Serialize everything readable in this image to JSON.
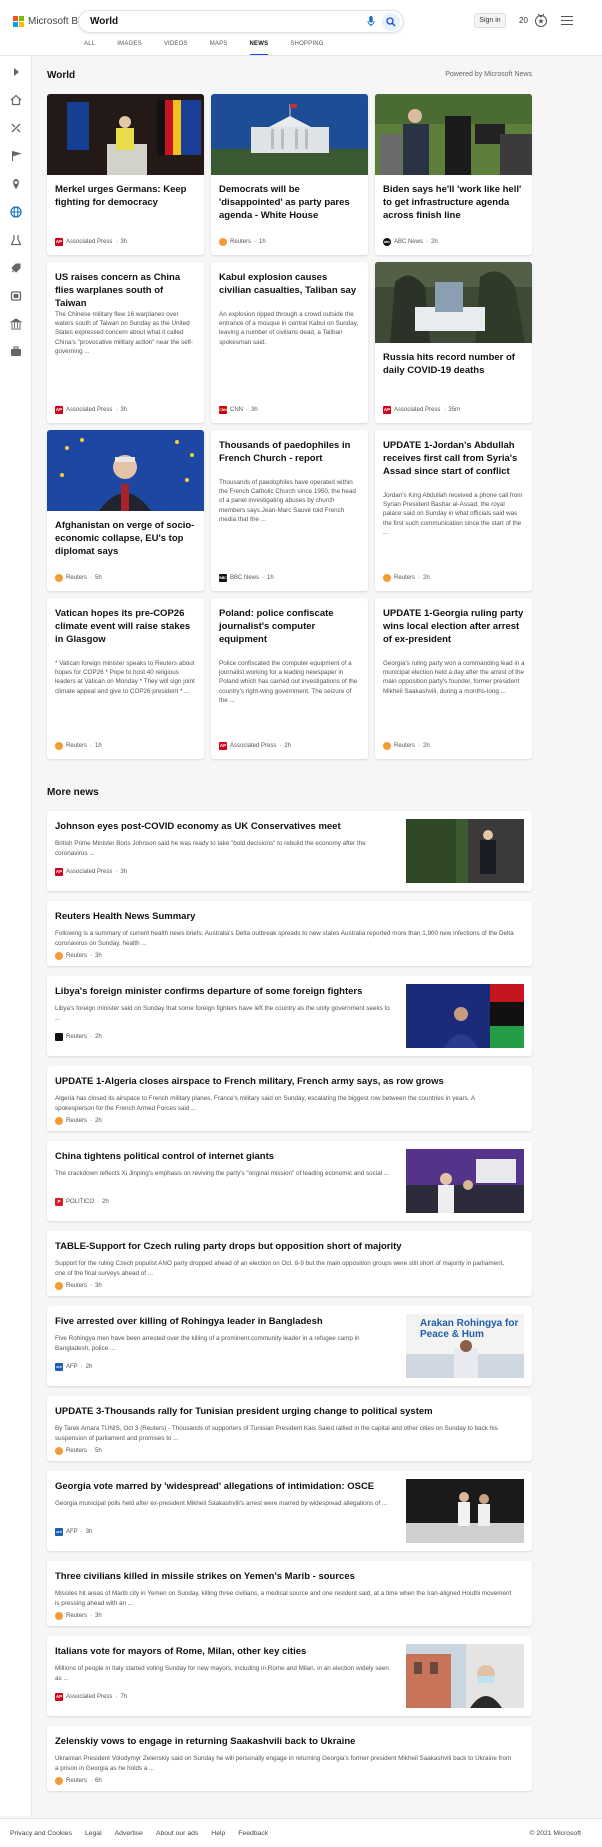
{
  "header": {
    "logo_text": "Microsoft Bing",
    "search_value": "World",
    "signin_label": "Sign in",
    "points": "20",
    "tabs": [
      "ALL",
      "IMAGES",
      "VIDEOS",
      "MAPS",
      "NEWS",
      "SHOPPING"
    ],
    "active_tab": "NEWS"
  },
  "rail_icons": [
    "expand-icon",
    "home-icon",
    "sports-icon",
    "flag-icon",
    "location-icon",
    "globe-icon",
    "science-icon",
    "tech-icon",
    "entertainment-icon",
    "politics-icon",
    "business-icon"
  ],
  "world": {
    "title": "World",
    "powered": "Powered by Microsoft News",
    "cards": [
      {
        "title": "Merkel urges Germans: Keep fighting for democracy",
        "snippet": "",
        "source": "Associated Press",
        "age": "3h",
        "logo": "AP"
      },
      {
        "title": "Democrats will be 'disappointed' as party pares agenda - White House",
        "snippet": "",
        "source": "Reuters",
        "age": "1h",
        "logo": "R"
      },
      {
        "title": "Biden says he'll 'work like hell' to get infrastructure agenda across finish line",
        "snippet": "",
        "source": "ABC News",
        "age": "2h",
        "logo": "abc"
      },
      {
        "title": "US raises concern as China flies warplanes south of Taiwan",
        "snippet": "The Chinese military flew 16 warplanes over waters south of Taiwan on Sunday as the United States expressed concern about what it called China's \"provocative military action\" near the self-governing ...",
        "source": "Associated Press",
        "age": "3h",
        "logo": "AP"
      },
      {
        "title": "Kabul explosion causes civilian casualties, Taliban say",
        "snippet": "An explosion ripped through a crowd outside the entrance of a mosque in central Kabul on Sunday, leaving a number of civilians dead, a Taliban spokesman said.",
        "source": "CNN",
        "age": "3h",
        "logo": "CNN"
      },
      {
        "title": "Russia hits record number of daily COVID-19 deaths",
        "snippet": "",
        "source": "Associated Press",
        "age": "35m",
        "logo": "AP"
      },
      {
        "title": "Afghanistan on verge of socio-economic collapse, EU's top diplomat says",
        "snippet": "",
        "source": "Reuters",
        "age": "5h",
        "logo": "R"
      },
      {
        "title": "Thousands of paedophiles in French Church - report",
        "snippet": "Thousands of paedophiles have operated within the French Catholic Church since 1950, the head of a panel investigating abuses by church members says.Jean-Marc Sauvé told French media that the ...",
        "source": "BBC News",
        "age": "1h",
        "logo": "BBC"
      },
      {
        "title": "UPDATE 1-Jordan's Abdullah receives first call from Syria's Assad since start of conflict",
        "snippet": "Jordan's King Abdullah received a phone call from Syrian President Bashar al-Assad, the royal palace said on Sunday in what officials said was the first such communication since the start of the ...",
        "source": "Reuters",
        "age": "2h",
        "logo": "R"
      },
      {
        "title": "Vatican hopes its pre-COP26 climate event will raise stakes in Glasgow",
        "snippet": "* Vatican foreign minister speaks to Reuters about hopes for COP26 * Pope to host 40 religious leaders at Vatican on Monday * They will sign joint climate appeal and give to COP26 president * ...",
        "source": "Reuters",
        "age": "1h",
        "logo": "R"
      },
      {
        "title": "Poland: police confiscate journalist's computer equipment",
        "snippet": "Police confiscated the computer equipment of a journalist working for a leading newspaper in Poland which has carried out investigations of the country's right-wing government. The seizure of the ...",
        "source": "Associated Press",
        "age": "2h",
        "logo": "AP"
      },
      {
        "title": "UPDATE 1-Georgia ruling party wins local election after arrest of ex-president",
        "snippet": "Georgia's ruling party won a commanding lead in a municipal election held a day after the arrest of the main opposition party's founder, former president Mikheil Saakashvili, during a months-long ...",
        "source": "Reuters",
        "age": "2h",
        "logo": "R"
      }
    ]
  },
  "more": {
    "title": "More news",
    "items": [
      {
        "title": "Johnson eyes post-COVID economy as UK Conservatives meet",
        "snippet": "British Prime Minister Boris Johnson said he was ready to take \"bold decisions\" to rebuild the economy after the coronavirus ...",
        "source": "Associated Press",
        "age": "3h",
        "logo": "AP"
      },
      {
        "title": "Reuters Health News Summary",
        "snippet": "Following is a summary of current health news briefs. Australia's Delta outbreak spreads to new states Australia reported more than 1,900 new infections of the Delta coronavirus on Sunday, health ...",
        "source": "Reuters",
        "age": "3h",
        "logo": "R"
      },
      {
        "title": "Libya's foreign minister confirms departure of some foreign fighters",
        "snippet": "Libya's foreign minister said on Sunday that some foreign fighters have left the country as the unity government seeks to ...",
        "source": "Reuters",
        "age": "2h",
        "logo": "R2"
      },
      {
        "title": "UPDATE 1-Algeria closes airspace to French military, French army says, as row grows",
        "snippet": "Algeria has closed its airspace to French military planes, France's military said on Sunday, escalating the biggest row between the countries in years. A spokesperson for the French Armed Forces said ...",
        "source": "Reuters",
        "age": "2h",
        "logo": "R"
      },
      {
        "title": "China tightens political control of internet giants",
        "snippet": "The crackdown reflects Xi Jinping's emphasis on reviving the party's \"original mission\" of leading economic and social ...",
        "source": "POLITICO",
        "age": "2h",
        "logo": "P"
      },
      {
        "title": "TABLE-Support for Czech ruling party drops but opposition short of majority",
        "snippet": "Support for the ruling Czech populist ANO party dropped ahead of an election on Oct. 8-9 but the main opposition groups were still short of majority in parliament, one of the final surveys ahead of ...",
        "source": "Reuters",
        "age": "3h",
        "logo": "R"
      },
      {
        "title": "Five arrested over killing of Rohingya leader in Bangladesh",
        "snippet": "Five Rohingya men have been arrested over the killing of a prominent community leader in a refugee camp in Bangladesh, police ...",
        "source": "AFP",
        "age": "2h",
        "logo": "AFP",
        "img_text": "Arakan Rohingya for Peace & Hum"
      },
      {
        "title": "UPDATE 3-Thousands rally for Tunisian president urging change to political system",
        "snippet": "By Tarek Amara TUNIS, Oct 3 (Reuters) - Thousands of supporters of Tunisian President Kais Saied rallied in the capital and other cities on Sunday to back his suspension of parliament and promises to ...",
        "source": "Reuters",
        "age": "5h",
        "logo": "R"
      },
      {
        "title": "Georgia vote marred by 'widespread' allegations of intimidation: OSCE",
        "snippet": "Georgia municipal polls held after ex-president Mikheil Saakashvili's arrest were marred by widespread allegations of ...",
        "source": "AFP",
        "age": "3h",
        "logo": "AFP"
      },
      {
        "title": "Three civilians killed in missile strikes on Yemen's Marib - sources",
        "snippet": "Missiles hit areas of Marib city in Yemen on Sunday, killing three civilians, a medical source and one resident said, at a time when the Iran-aligned Houthi movement is pressing ahead with an ...",
        "source": "Reuters",
        "age": "3h",
        "logo": "R"
      },
      {
        "title": "Italians vote for mayors of Rome, Milan, other key cities",
        "snippet": "Millions of people in Italy started voting Sunday for new mayors, including in Rome and Milan, in an election widely seen as ...",
        "source": "Associated Press",
        "age": "7h",
        "logo": "AP"
      },
      {
        "title": "Zelenskiy vows to engage in returning Saakashvili back to Ukraine",
        "snippet": "Ukrainian President Volodymyr Zelenskiy said on Sunday he will personally engage in returning Georgia's former president Mikheil Saakashvili back to Ukraine from a prison in Georgia as he holds a ...",
        "source": "Reuters",
        "age": "6h",
        "logo": "R"
      }
    ]
  },
  "footer": {
    "links": [
      "Privacy and Cookies",
      "Legal",
      "Advertise",
      "About our ads",
      "Help",
      "Feedback"
    ],
    "copyright": "© 2021 Microsoft"
  },
  "colors": {
    "accent": "#174ae4",
    "ap": "#d6001c",
    "reuters": "#f39c35",
    "cnn": "#cc0000",
    "bbc": "#111111",
    "politico": "#d61f26",
    "afp": "#1a5fb4"
  }
}
